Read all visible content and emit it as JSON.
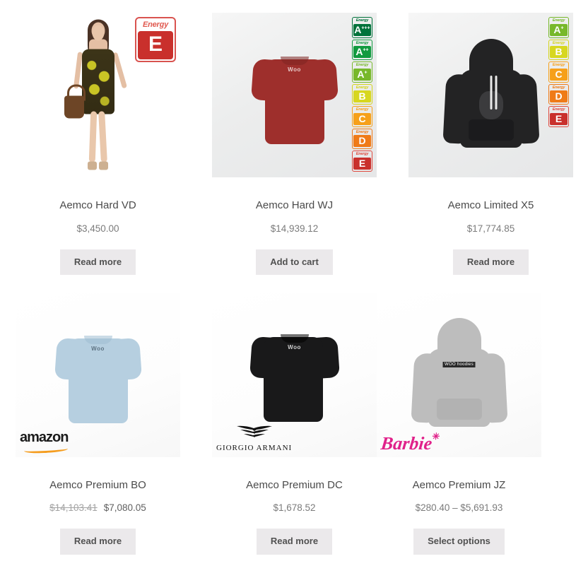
{
  "shop": {
    "columns": 3,
    "accent_button_bg": "#ebe9eb",
    "accent_button_text": "#515151",
    "products": [
      {
        "id": "aemco-hard-vd",
        "title": "Aemco Hard VD",
        "price": "$3,450.00",
        "button_label": "Read more",
        "button_action": "read-more",
        "image_kind": "dress-model",
        "image_bg": "#ffffff",
        "energy_labels": [
          {
            "grade": "E",
            "sup": "",
            "word": "Energy",
            "bg": "#c9302c",
            "word_color": "#e0594f",
            "size": "big"
          }
        ],
        "brand_logo": null
      },
      {
        "id": "aemco-hard-wj",
        "title": "Aemco Hard WJ",
        "price": "$14,939.12",
        "button_label": "Add to cart",
        "button_action": "add-to-cart",
        "image_kind": "tee-red",
        "image_bg": "#ececed",
        "energy_labels": [
          {
            "grade": "A",
            "sup": "+++",
            "word": "Energy",
            "bg": "#00723a",
            "word_color": "#00723a",
            "size": "small"
          },
          {
            "grade": "A",
            "sup": "++",
            "word": "Energy",
            "bg": "#119a3f",
            "word_color": "#119a3f",
            "size": "small"
          },
          {
            "grade": "A",
            "sup": "+",
            "word": "Energy",
            "bg": "#77b82a",
            "word_color": "#77b82a",
            "size": "small"
          },
          {
            "grade": "B",
            "sup": "",
            "word": "Energy",
            "bg": "#d7d71f",
            "word_color": "#d4d41c",
            "size": "small"
          },
          {
            "grade": "C",
            "sup": "",
            "word": "Energy",
            "bg": "#f6a01a",
            "word_color": "#f6a01a",
            "size": "small"
          },
          {
            "grade": "D",
            "sup": "",
            "word": "Energy",
            "bg": "#ef7b18",
            "word_color": "#ef7b18",
            "size": "small"
          },
          {
            "grade": "E",
            "sup": "",
            "word": "Energy",
            "bg": "#c9302c",
            "word_color": "#e04a3f",
            "size": "small"
          }
        ],
        "brand_logo": null
      },
      {
        "id": "aemco-limited-x5",
        "title": "Aemco Limited X5",
        "price": "$17,774.85",
        "button_label": "Read more",
        "button_action": "read-more",
        "image_kind": "hoodie-black",
        "image_bg": "#ececed",
        "energy_labels": [
          {
            "grade": "A",
            "sup": "+",
            "word": "Energy",
            "bg": "#77b82a",
            "word_color": "#77b82a",
            "size": "small"
          },
          {
            "grade": "B",
            "sup": "",
            "word": "Energy",
            "bg": "#d7d71f",
            "word_color": "#d4d41c",
            "size": "small"
          },
          {
            "grade": "C",
            "sup": "",
            "word": "Energy",
            "bg": "#f6a01a",
            "word_color": "#f6a01a",
            "size": "small"
          },
          {
            "grade": "D",
            "sup": "",
            "word": "Energy",
            "bg": "#ef7b18",
            "word_color": "#ef7b18",
            "size": "small"
          },
          {
            "grade": "E",
            "sup": "",
            "word": "Energy",
            "bg": "#c9302c",
            "word_color": "#e04a3f",
            "size": "small"
          }
        ],
        "brand_logo": null
      },
      {
        "id": "aemco-premium-bo",
        "title": "Aemco Premium BO",
        "price_original": "$14,103.41",
        "price_sale": "$7,080.05",
        "button_label": "Read more",
        "button_action": "read-more",
        "image_kind": "tee-blue",
        "image_bg": "#f4f4f4",
        "energy_labels": [],
        "brand_logo": {
          "name": "amazon",
          "text": "amazon",
          "color": "#1b1b1b",
          "accent": "#f59d1f"
        }
      },
      {
        "id": "aemco-premium-dc",
        "title": "Aemco Premium DC",
        "price": "$1,678.52",
        "button_label": "Read more",
        "button_action": "read-more",
        "image_kind": "tee-black",
        "image_bg": "#f4f4f4",
        "energy_labels": [],
        "brand_logo": {
          "name": "giorgio-armani",
          "text": "GIORGIO ARMANI",
          "color": "#111111",
          "accent": "#111111"
        }
      },
      {
        "id": "aemco-premium-jz",
        "title": "Aemco Premium JZ",
        "price": "$280.40 – $5,691.93",
        "button_label": "Select options",
        "button_action": "select-options",
        "image_kind": "hoodie-gray",
        "image_bg": "#f4f4f4",
        "energy_labels": [],
        "brand_logo": {
          "name": "barbie",
          "text": "Barbie",
          "color": "#e0218a",
          "accent": "#e0218a"
        }
      }
    ]
  },
  "garment_marks": {
    "woo": "Woo",
    "woo_hoodie": "WOO hoodies"
  }
}
